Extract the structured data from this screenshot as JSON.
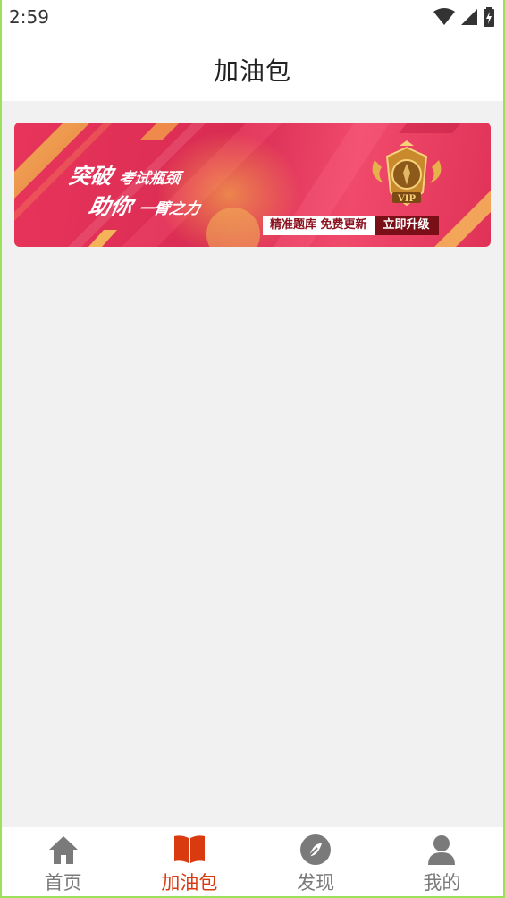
{
  "status_bar": {
    "time": "2:59",
    "icons": [
      "wifi-icon",
      "cellular-signal-icon",
      "battery-charging-icon"
    ]
  },
  "header": {
    "title": "加油包"
  },
  "banner": {
    "headline_line1_big": "突破",
    "headline_line1_small": "考试瓶颈",
    "headline_line2_big": "助你",
    "headline_line2_small": "一臂之力",
    "badge_text": "VIP",
    "tag_left": "精准题库 免费更新",
    "tag_right": "立即升级",
    "colors": {
      "background": "#e03257",
      "tag_dark": "#7a0f18",
      "gold": "#e7b04a"
    }
  },
  "tabbar": {
    "active_color": "#d93a10",
    "inactive_color": "#7a7a7a",
    "items": [
      {
        "label": "首页",
        "icon": "home-icon"
      },
      {
        "label": "加油包",
        "icon": "book-icon"
      },
      {
        "label": "发现",
        "icon": "compass-icon"
      },
      {
        "label": "我的",
        "icon": "person-icon"
      }
    ],
    "active_index": 1
  }
}
